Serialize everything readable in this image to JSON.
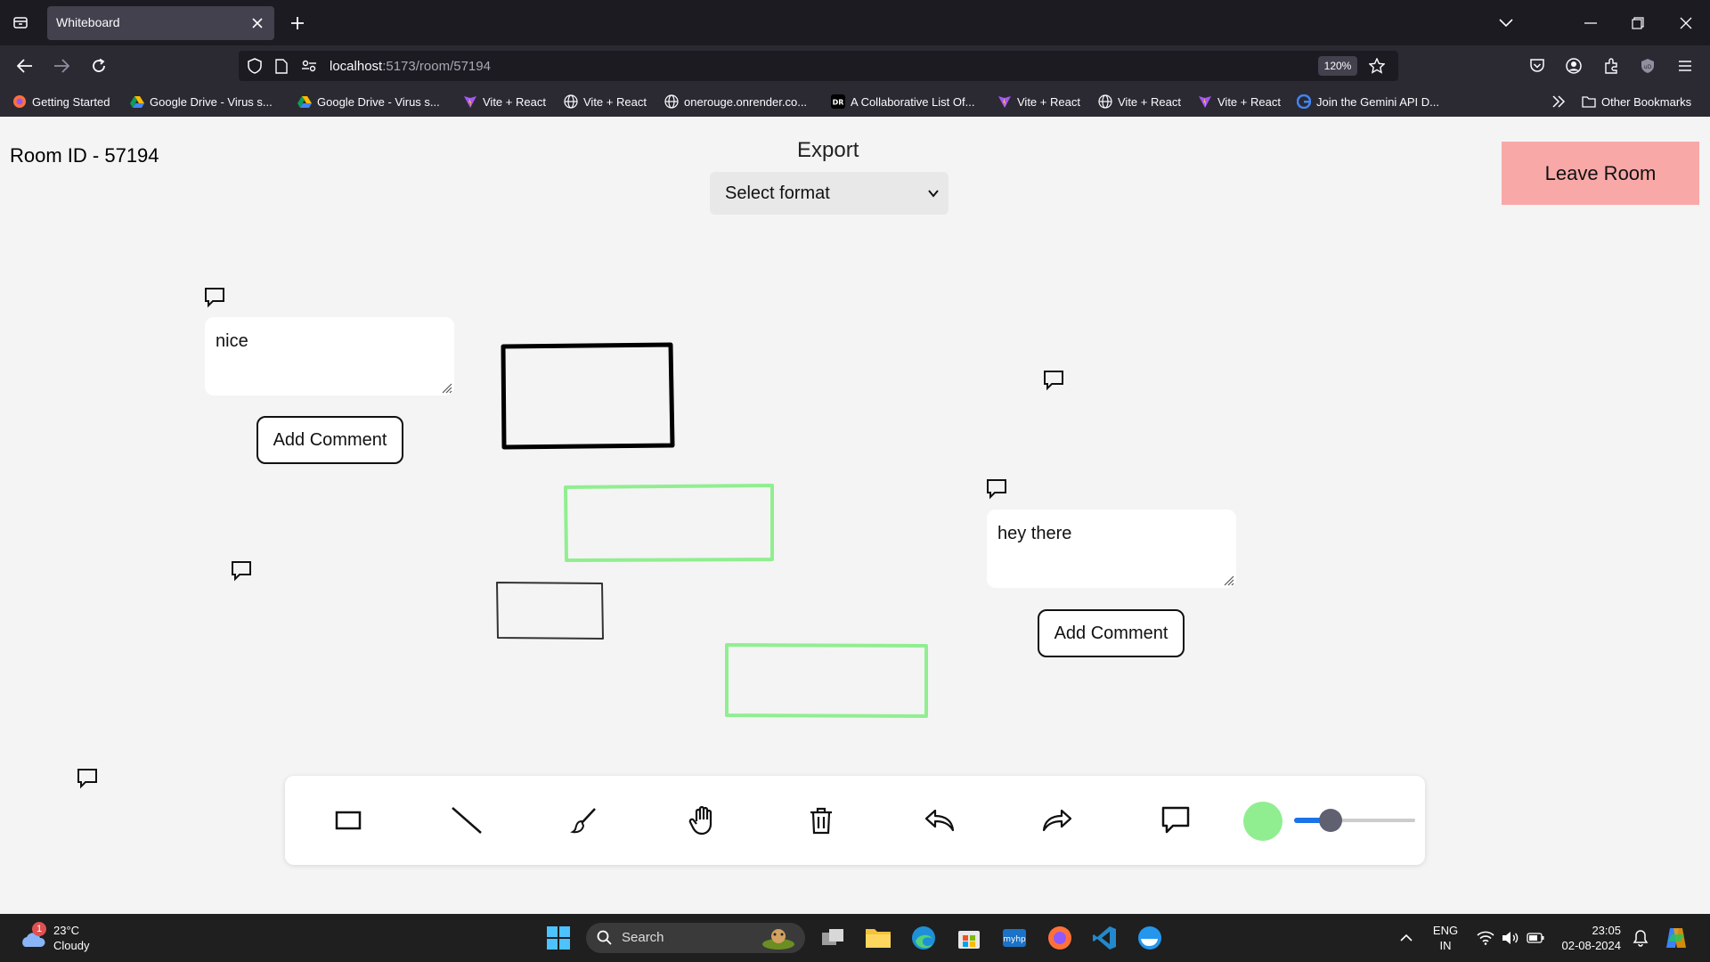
{
  "browser": {
    "tab_title": "Whiteboard",
    "url_host": "localhost",
    "url_rest": ":5173/room/57194",
    "zoom": "120%",
    "bookmarks": [
      "Getting Started",
      "Google Drive - Virus s...",
      "Google Drive - Virus s...",
      "Vite + React",
      "Vite + React",
      "onerouge.onrender.co...",
      "A Collaborative List Of...",
      "Vite + React",
      "Vite + React",
      "Vite + React",
      "Join the Gemini API D..."
    ],
    "other_bookmarks": "Other Bookmarks"
  },
  "app": {
    "room_id": "Room ID - 57194",
    "export_label": "Export",
    "export_select": "Select format",
    "leave_button": "Leave Room",
    "comments": [
      {
        "text": "nice",
        "button": "Add Comment"
      },
      {
        "text": "hey there",
        "button": "Add Comment"
      }
    ],
    "stroke_color": "#90ee90",
    "stroke_width_level": 0.25,
    "shapes": [
      {
        "type": "rectangle",
        "color": "#000000",
        "stroke": "thick"
      },
      {
        "type": "rectangle",
        "color": "#90ee90",
        "stroke": "medium"
      },
      {
        "type": "rectangle",
        "color": "#333333",
        "stroke": "thin"
      },
      {
        "type": "rectangle",
        "color": "#90ee90",
        "stroke": "medium"
      }
    ],
    "toolbar_tools": [
      "rectangle-tool",
      "line-tool",
      "brush-tool",
      "pan-tool",
      "delete-tool",
      "undo-tool",
      "redo-tool",
      "comment-tool"
    ]
  },
  "taskbar": {
    "weather_temp": "23°C",
    "weather_desc": "Cloudy",
    "weather_badge": "1",
    "search": "Search",
    "lang_1": "ENG",
    "lang_2": "IN",
    "time": "23:05",
    "date": "02-08-2024"
  }
}
